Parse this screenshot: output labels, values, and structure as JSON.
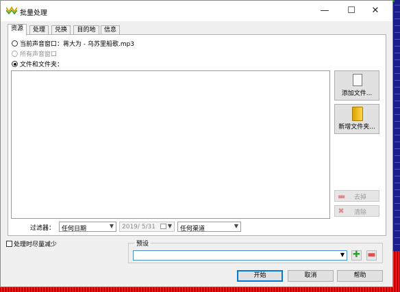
{
  "window": {
    "title": "批量处理",
    "minimize_glyph": "—",
    "maximize_glyph": "☐",
    "close_glyph": "✕"
  },
  "tabs": [
    {
      "label": "资源",
      "active": true
    },
    {
      "label": "处理",
      "active": false
    },
    {
      "label": "兑换",
      "active": false
    },
    {
      "label": "目的地",
      "active": false
    },
    {
      "label": "信息",
      "active": false
    }
  ],
  "source": {
    "current_window_label": "当前声音窗口：",
    "current_file": "蒋大为 - 乌苏里船歌.mp3",
    "all_windows_label": "所有声音窗口",
    "files_folders_label": "文件和文件夹："
  },
  "side_buttons": {
    "add_file": "添加文件...",
    "add_folder": "新增文件夹...",
    "remove": "去掉",
    "clear": "清除"
  },
  "filter": {
    "label": "过滤器：",
    "date_option": "任何日期",
    "date_value": "2019/ 5/31",
    "channel_option": "任何渠道"
  },
  "reduce_checkbox_label": "处理时尽量减少",
  "preset": {
    "label": "预设",
    "value": ""
  },
  "actions": {
    "start": "开始",
    "cancel": "取消",
    "help": "帮助"
  },
  "icons": {
    "app": "batch-icon",
    "add_file": "document-icon",
    "add_folder": "folder-icon",
    "remove": "minus-icon",
    "clear": "x-icon",
    "preset_add": "plus-icon",
    "preset_remove": "minus-icon"
  },
  "colors": {
    "accent": "#0078d7",
    "plus": "#2aa52a",
    "minus": "#e05050"
  }
}
